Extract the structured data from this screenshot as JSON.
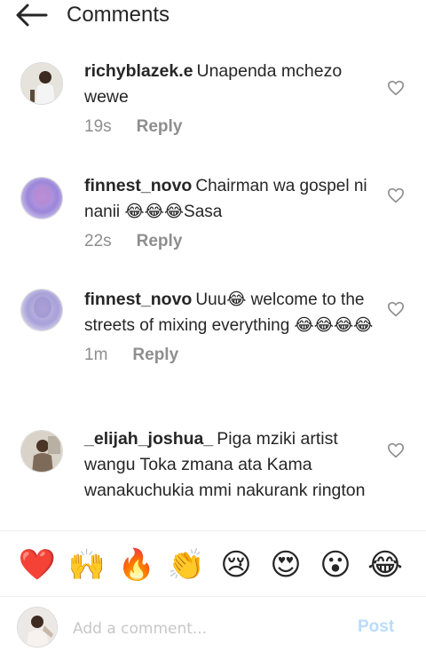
{
  "header": {
    "title": "Comments",
    "back_icon": "arrow-left-icon"
  },
  "comments": [
    {
      "username": "richyblazek.e",
      "text": "Unapenda mchezo wewe",
      "time": "19s",
      "reply": "Reply"
    },
    {
      "username": "finnest_novo",
      "text": "Chairman wa gospel ni nanii 😂😂😂Sasa",
      "time": "22s",
      "reply": "Reply"
    },
    {
      "username": "finnest_novo",
      "text": "Uuu😂 welcome to the streets of mixing everything 😂😂😂😂",
      "time": "1m",
      "reply": "Reply"
    },
    {
      "username": "_elijah_joshua_",
      "text": "Piga mziki artist wangu Toka zmana ata Kama wanakuchukia mmi nakurank rington",
      "time": "",
      "reply": ""
    }
  ],
  "emoji_bar": {
    "emojis": [
      "❤️",
      "🙌",
      "🔥",
      "👏",
      "😢",
      "😍",
      "😮",
      "😂"
    ]
  },
  "input": {
    "placeholder": "Add a comment...",
    "post_label": "Post"
  },
  "colors": {
    "text": "#262626",
    "secondary": "#8e8e8e",
    "post_disabled": "#b9dcfb",
    "heart_outline": "#8e8e8e"
  }
}
